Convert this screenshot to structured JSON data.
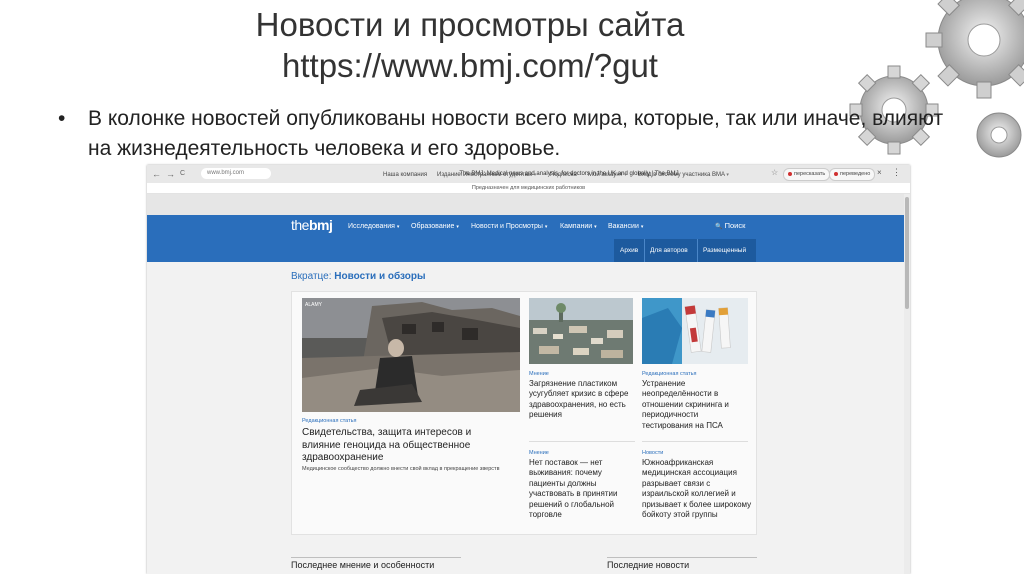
{
  "slide": {
    "title_line1": "Новости и просмотры сайта",
    "title_line2": "https://www.bmj.com/?gut",
    "bullet_symbol": "•",
    "bullet": "В колонке новостей опубликованы новости всего мира, которые, так или иначе, влияют на жизнедеятельность человека и его здоровье."
  },
  "browser": {
    "back_icon": "←",
    "forward_icon": "→",
    "reload_icon": "C",
    "url": "www.bmj.com",
    "tab_title": "The BMJ: Medical news and analysis, for doctors in the UK and globally | The BMJ",
    "star_icon": "☆",
    "translate_label": "пересказать",
    "translated_label": "переведено",
    "close_icon": "×",
    "menu_icon": "⋮"
  },
  "site": {
    "notice": "Предназначен для медицинских работников",
    "utility_links": [
      "Наша компания",
      "Издание:",
      "Иностранным студентам",
      "Подписка",
      "Мой аккаунт",
      "Вход в систему участника BMA"
    ],
    "logo_the": "the",
    "logo_bmj": "bmj",
    "nav": [
      "Исследования",
      "Образование",
      "Новости и Просмотры",
      "Кампании",
      "Вакансии"
    ],
    "search": "Поиск",
    "search_icon": "🔍",
    "subnav": [
      "Архив",
      "Для авторов",
      "Размещенный"
    ],
    "brief_prefix": "Вкратце:",
    "brief_title": "Новости и обзоры",
    "main_story": {
      "photo_credit": "ALAMY",
      "kicker": "Редакционная статья",
      "headline": "Свидетельства, защита интересов и влияние геноцида на общественное здравоохранение",
      "standfirst": "Медицинское сообщество должно внести свой вклад в прекращение зверств"
    },
    "stories": [
      {
        "kicker": "Мнение",
        "headline": "Загрязнение пластиком усугубляет кризис в сфере здравоохранения, но есть решения"
      },
      {
        "kicker": "Редакционная статья",
        "headline": "Устранение неопределённости в отношении скрининга и периодичности тестирования на ПСА"
      },
      {
        "kicker": "Мнение",
        "headline": "Нет поставок — нет выживания: почему пациенты должны участвовать в принятии решений о глобальной торговле"
      },
      {
        "kicker": "Новости",
        "headline": "Южноафриканская медицинская ассоциация разрывает связи с израильской коллегией и призывает к более широкому бойкоту этой группы"
      }
    ],
    "bottom_left": "Последнее мнение и особенности",
    "bottom_right": "Последние новости"
  },
  "colors": {
    "brand_blue": "#2a6ebb",
    "subnav_blue": "#1d5a9e"
  }
}
